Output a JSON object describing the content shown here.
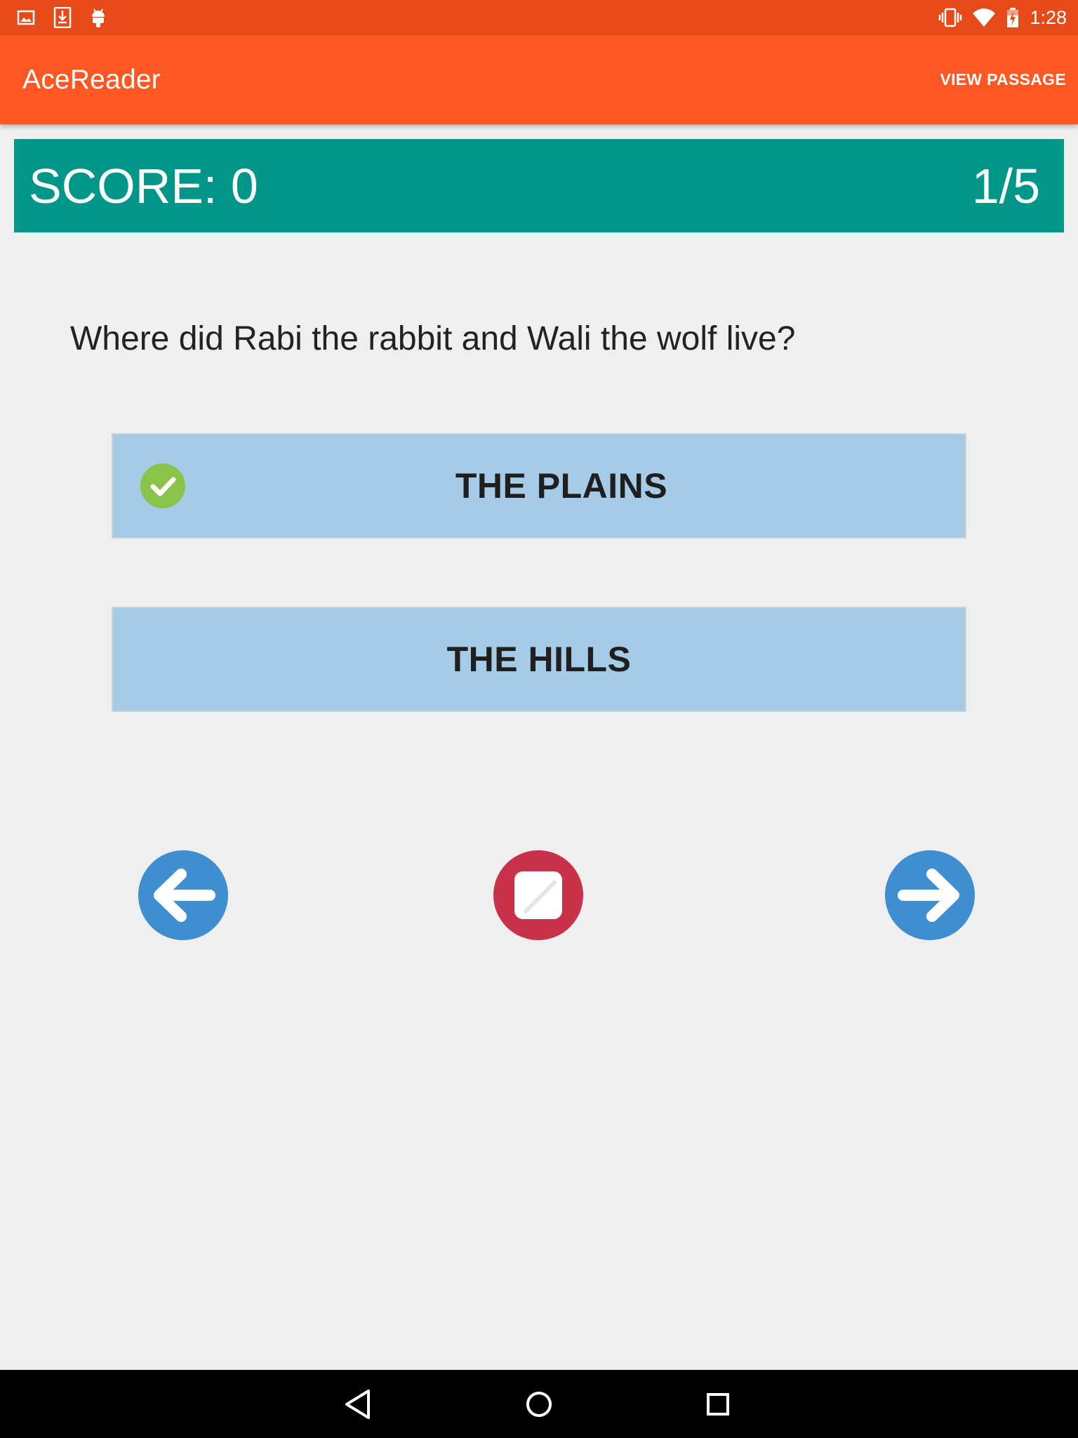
{
  "status_bar": {
    "time": "1:28",
    "left_icons": [
      "image-icon",
      "download-icon",
      "android-icon"
    ],
    "right_icons": [
      "vibrate-icon",
      "wifi-icon",
      "battery-icon"
    ]
  },
  "app_bar": {
    "title": "AceReader",
    "action_label": "VIEW PASSAGE"
  },
  "score_bar": {
    "score_text": "SCORE: 0",
    "progress_text": "1/5"
  },
  "quiz": {
    "question": "Where did Rabi the rabbit and Wali the wolf live?",
    "answers": [
      {
        "label": "THE PLAINS",
        "marked_correct": true
      },
      {
        "label": "THE HILLS",
        "marked_correct": false
      }
    ]
  },
  "controls": {
    "icons": [
      "arrow-left-icon",
      "stop-icon",
      "arrow-right-icon"
    ]
  },
  "system_nav": {
    "icons": [
      "back-icon",
      "home-icon",
      "recents-icon"
    ]
  },
  "colors": {
    "status_bar": "#e64a19",
    "app_bar": "#ff5722",
    "score_bar": "#009688",
    "answer_bg": "#a5cbe6",
    "check_green": "#8bc34a",
    "nav_blue": "#3f8fd0",
    "stop_red": "#c9304a",
    "background": "#efefef"
  }
}
